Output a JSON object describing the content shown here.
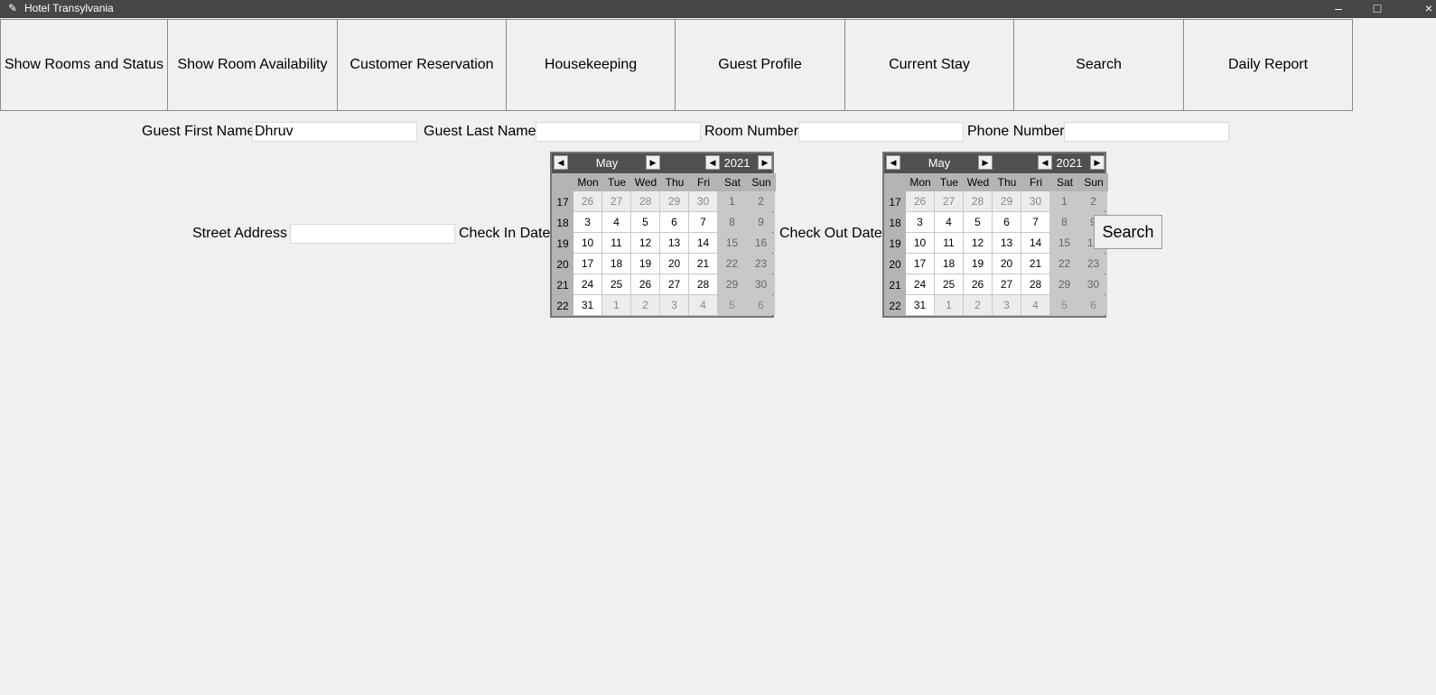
{
  "window": {
    "title": "Hotel Transylvania",
    "icon": "feather-icon",
    "minimize_glyph": "–",
    "maximize_glyph": "□",
    "close_glyph": "×"
  },
  "nav": [
    {
      "label": "Show Rooms and Status"
    },
    {
      "label": "Show Room Availability"
    },
    {
      "label": "Customer Reservation"
    },
    {
      "label": "Housekeeping"
    },
    {
      "label": "Guest Profile"
    },
    {
      "label": "Current Stay"
    },
    {
      "label": "Search"
    },
    {
      "label": "Daily Report"
    }
  ],
  "form": {
    "first_name_label": "Guest First Name",
    "first_name_value": "Dhruv",
    "last_name_label": "Guest Last Name",
    "last_name_value": "",
    "room_number_label": "Room Number",
    "room_number_value": "",
    "phone_label": "Phone Number",
    "phone_value": "",
    "street_label": "Street Address",
    "street_value": "",
    "checkin_label": "Check In Date",
    "checkout_label": "Check Out Date",
    "search_label": "Search"
  },
  "calendar": {
    "month": "May",
    "year": "2021",
    "weekdays": [
      "Mon",
      "Tue",
      "Wed",
      "Thu",
      "Fri",
      "Sat",
      "Sun"
    ],
    "weeks": [
      {
        "num": "17",
        "days": [
          "26",
          "27",
          "28",
          "29",
          "30",
          "1",
          "2"
        ]
      },
      {
        "num": "18",
        "days": [
          "3",
          "4",
          "5",
          "6",
          "7",
          "8",
          "9"
        ]
      },
      {
        "num": "19",
        "days": [
          "10",
          "11",
          "12",
          "13",
          "14",
          "15",
          "16"
        ]
      },
      {
        "num": "20",
        "days": [
          "17",
          "18",
          "19",
          "20",
          "21",
          "22",
          "23"
        ]
      },
      {
        "num": "21",
        "days": [
          "24",
          "25",
          "26",
          "27",
          "28",
          "29",
          "30"
        ]
      },
      {
        "num": "22",
        "days": [
          "31",
          "1",
          "2",
          "3",
          "4",
          "5",
          "6"
        ]
      }
    ]
  },
  "colors": {
    "titlebar": "#484644",
    "calendar_header": "#505050",
    "weekend_cell": "#c8c8c8",
    "window_bg": "#f0f0f0"
  }
}
